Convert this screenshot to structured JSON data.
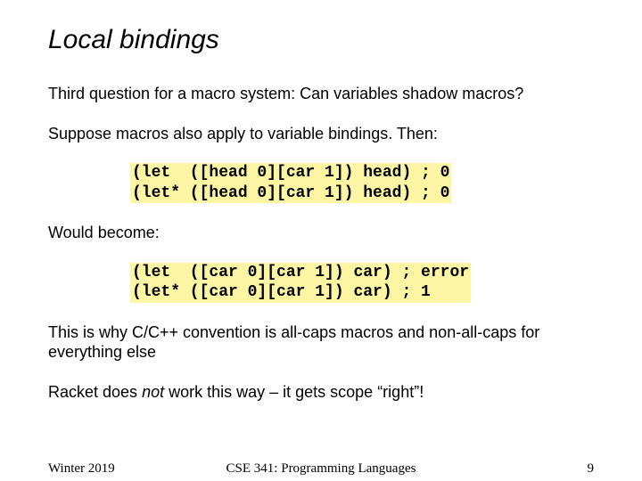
{
  "title": "Local bindings",
  "q_line": "Third question for a macro system: Can variables shadow macros?",
  "suppose": "Suppose macros also apply to variable bindings.  Then:",
  "code1": "(let  ([head 0][car 1]) head) ; 0\n(let* ([head 0][car 1]) head) ; 0",
  "would_become": "Would become:",
  "code2": "(let  ([car 0][car 1]) car) ; error\n(let* ([car 0][car 1]) car) ; 1",
  "whycpp": "This is why C/C++ convention is all-caps macros and non-all-caps for everything else",
  "racket_pre": "Racket does ",
  "racket_em": "not",
  "racket_post": " work this way – it gets scope “right”!",
  "footer": {
    "left": "Winter 2019",
    "center": "CSE 341: Programming Languages",
    "right": "9"
  }
}
